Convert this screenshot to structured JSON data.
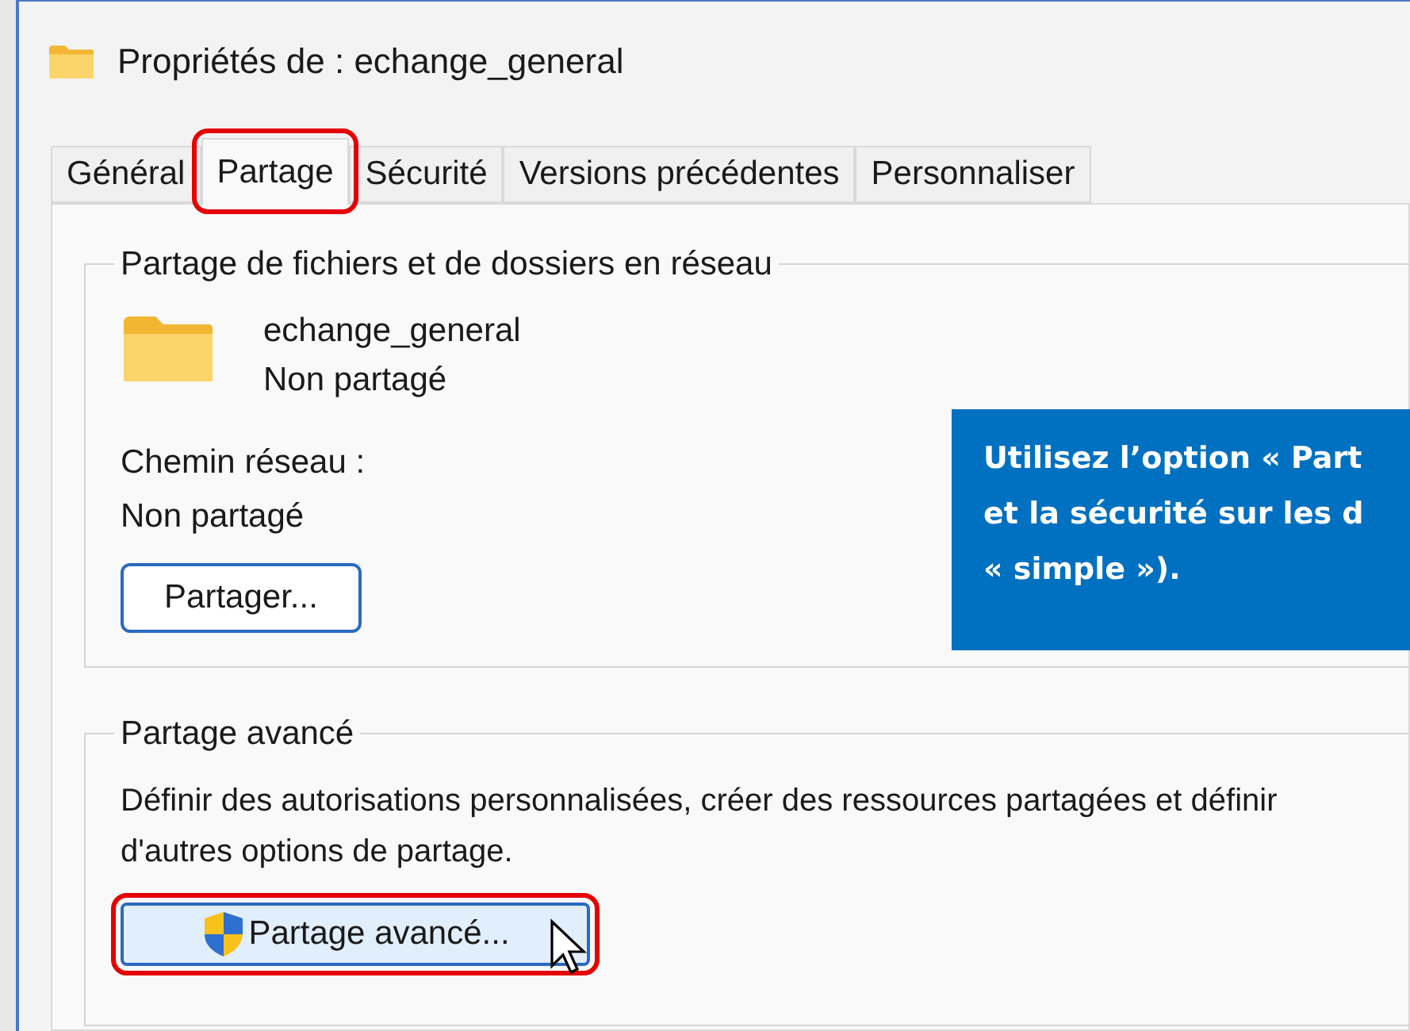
{
  "window": {
    "title": "Propriétés de : echange_general"
  },
  "tabs": [
    {
      "label": "Général",
      "selected": false,
      "highlighted": false
    },
    {
      "label": "Partage",
      "selected": true,
      "highlighted": true
    },
    {
      "label": "Sécurité",
      "selected": false,
      "highlighted": false
    },
    {
      "label": "Versions précédentes",
      "selected": false,
      "highlighted": false
    },
    {
      "label": "Personnaliser",
      "selected": false,
      "highlighted": false
    }
  ],
  "network_sharing": {
    "legend": "Partage de fichiers et de dossiers en réseau",
    "folder_name": "echange_general",
    "status": "Non partagé",
    "path_label": "Chemin réseau :",
    "path_value": "Non partagé",
    "button": "Partager..."
  },
  "advanced_sharing": {
    "legend": "Partage avancé",
    "description": "Définir des autorisations personnalisées, créer des ressources partagées et définir d'autres options de partage.",
    "button": {
      "label": "Partage avancé...",
      "highlighted": true,
      "hovered": true
    }
  },
  "callout": {
    "lines": [
      "Utilisez l’option « Part",
      "et la sécurité sur les d",
      "« simple »)."
    ]
  }
}
